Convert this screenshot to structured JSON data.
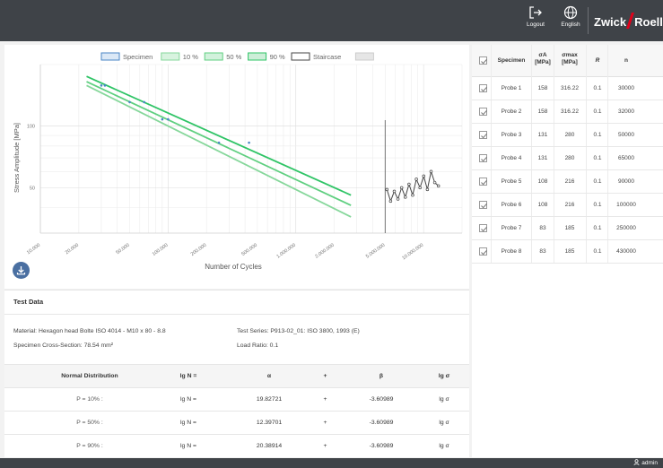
{
  "header": {
    "logout_label": "Logout",
    "language_label": "English",
    "logo_left": "Zwick",
    "logo_right": "Roell",
    "logo_accent": "#e2001a",
    "bar_color": "#3f4348"
  },
  "legend": [
    {
      "label": "Specimen",
      "color": "#4a86c5",
      "fill": "#dbe8f6"
    },
    {
      "label": "10 %",
      "color": "#86d79b",
      "fill": "#d8f3df"
    },
    {
      "label": "50 %",
      "color": "#5fcf80",
      "fill": "#d2f1dc"
    },
    {
      "label": "90 %",
      "color": "#2fc466",
      "fill": "#cdeed8"
    },
    {
      "label": "Staircase",
      "color": "#444444",
      "fill": "#ffffff"
    },
    {
      "label": "",
      "color": "#cccccc",
      "fill": "#e6e6e6"
    }
  ],
  "chart_data": {
    "type": "line",
    "xlabel": "Number of Cycles",
    "ylabel": "Stress Amplitude [MPa]",
    "x_scale": "log",
    "y_scale": "log",
    "xlim": [
      10000,
      20000000
    ],
    "ylim": [
      30,
      200
    ],
    "x_ticks": [
      10000,
      20000,
      50000,
      100000,
      200000,
      500000,
      1000000,
      2000000,
      5000000,
      10000000
    ],
    "x_tick_labels": [
      "10.000",
      "20.000",
      "50.000",
      "100.000",
      "200.000",
      "500.000",
      "1.000.000",
      "2.000.000",
      "5.000.000",
      "10.000.000"
    ],
    "y_ticks": [
      50,
      100
    ],
    "y_tick_labels": [
      "50",
      "100"
    ],
    "grid": true,
    "series": [
      {
        "name": "10 %",
        "color": "#86d79b",
        "x": [
          23000,
          2700000
        ],
        "y": [
          158,
          36
        ]
      },
      {
        "name": "50 %",
        "color": "#5fcf80",
        "x": [
          23000,
          2700000
        ],
        "y": [
          165,
          41
        ]
      },
      {
        "name": "90 %",
        "color": "#2fc466",
        "x": [
          23000,
          2700000
        ],
        "y": [
          175,
          46
        ]
      },
      {
        "name": "Specimen",
        "color": "#4a86c5",
        "type": "scatter",
        "x": [
          30000,
          32000,
          50000,
          65000,
          90000,
          100000,
          250000,
          430000
        ],
        "y": [
          158,
          158,
          131,
          131,
          108,
          108,
          83,
          83
        ]
      }
    ],
    "staircase": {
      "color": "#444444",
      "start_cycles": 5000000,
      "points": [
        49,
        43,
        48,
        44,
        50,
        45,
        52,
        46,
        55,
        50,
        57,
        49,
        60,
        53,
        51
      ]
    }
  },
  "test_data": {
    "title": "Test Data",
    "material": "Material: Hexagon head Bolte ISO 4014 - M10 x 80 - 8.8",
    "cross_section": "Specimen Cross-Section: 78.54 mm²",
    "test_series": "Test Series: P913-02_01: ISO 3800, 1993 (E)",
    "load_ratio": "Load Ratio: 0.1"
  },
  "normal_distribution": {
    "headers": [
      "Normal Distribution",
      "lg N =",
      "α",
      "+",
      "β",
      "lg σ"
    ],
    "rows": [
      [
        "P = 10% :",
        "lg N =",
        "19.82721",
        "+",
        "-3.60989",
        "lg σ"
      ],
      [
        "P = 50% :",
        "lg N =",
        "12.39701",
        "+",
        "-3.60989",
        "lg σ"
      ],
      [
        "P = 90% :",
        "lg N =",
        "20.38914",
        "+",
        "-3.60989",
        "lg σ"
      ]
    ]
  },
  "specimen_table": {
    "headers": {
      "specimen": "Specimen",
      "sigma_a": "σA",
      "sigma_a_unit": "[MPa]",
      "sigma_max": "σmax",
      "sigma_max_unit": "[MPa]",
      "r": "R",
      "n": "n"
    },
    "rows": [
      {
        "checked": true,
        "specimen": "Probe 1",
        "sa": "158",
        "smax": "316.22",
        "r": "0.1",
        "n": "30000"
      },
      {
        "checked": true,
        "specimen": "Probe 2",
        "sa": "158",
        "smax": "316.22",
        "r": "0.1",
        "n": "32000"
      },
      {
        "checked": true,
        "specimen": "Probe 3",
        "sa": "131",
        "smax": "280",
        "r": "0.1",
        "n": "50000"
      },
      {
        "checked": true,
        "specimen": "Probe 4",
        "sa": "131",
        "smax": "280",
        "r": "0.1",
        "n": "65000"
      },
      {
        "checked": true,
        "specimen": "Probe 5",
        "sa": "108",
        "smax": "216",
        "r": "0.1",
        "n": "90000"
      },
      {
        "checked": true,
        "specimen": "Probe 6",
        "sa": "108",
        "smax": "216",
        "r": "0.1",
        "n": "100000"
      },
      {
        "checked": true,
        "specimen": "Probe 7",
        "sa": "83",
        "smax": "185",
        "r": "0.1",
        "n": "250000"
      },
      {
        "checked": true,
        "specimen": "Probe 8",
        "sa": "83",
        "smax": "185",
        "r": "0.1",
        "n": "430000"
      }
    ]
  },
  "footer": {
    "user_label": "admin"
  }
}
